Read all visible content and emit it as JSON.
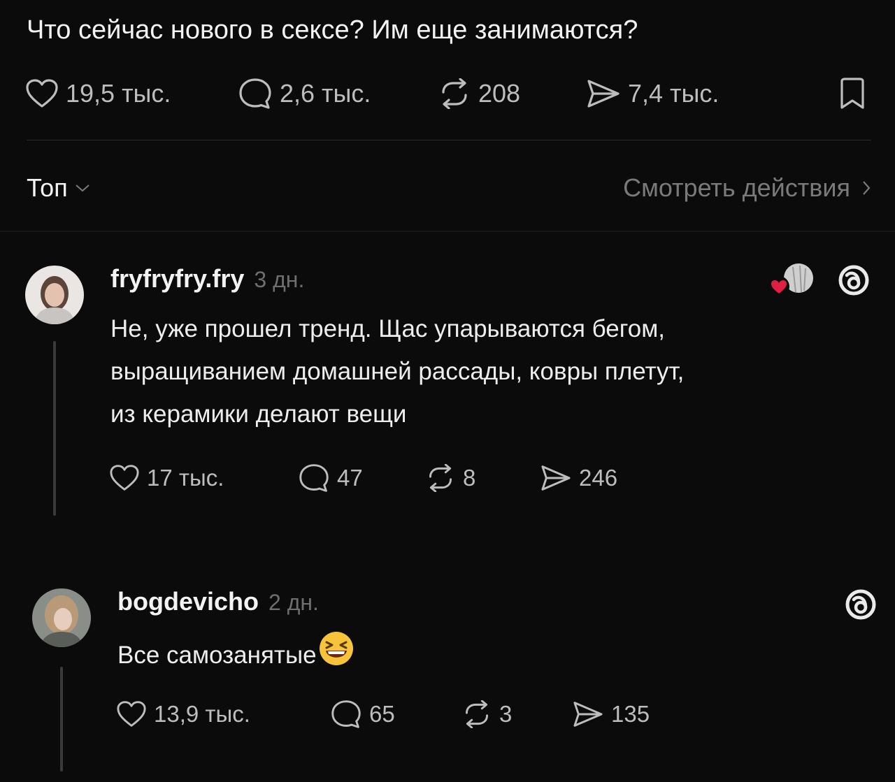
{
  "post": {
    "text": "Что сейчас нового в сексе? Им еще занимаются?",
    "likes": "19,5 тыс.",
    "replies": "2,6 тыс.",
    "reposts": "208",
    "shares": "7,4 тыс."
  },
  "sort_bar": {
    "sort_label": "Топ",
    "view_activity": "Смотреть действия"
  },
  "comments": [
    {
      "username": "fryfryfry.fry",
      "time": "3 дн.",
      "text_lines": [
        "Не, уже прошел тренд. Щас упарываются бегом,",
        "выращиванием домашней рассады, ковры плетут,",
        "из керамики делают вещи"
      ],
      "likes": "17 тыс.",
      "replies": "47",
      "reposts": "8",
      "shares": "246"
    },
    {
      "username": "bogdevicho",
      "time": "2 дн.",
      "text": "Все самозанятые",
      "emoji": "😆",
      "likes": "13,9 тыс.",
      "replies": "65",
      "reposts": "3",
      "shares": "135"
    }
  ],
  "colors": {
    "background": "#0c0b0c",
    "text": "#f3f3f3",
    "muted": "#7a7a7a",
    "icon": "#bdbdbd",
    "like_badge": "#e02040"
  },
  "icons": [
    "heart-icon",
    "comment-icon",
    "repost-icon",
    "share-icon",
    "bookmark-icon",
    "chevron-down-icon",
    "chevron-right-icon",
    "threads-logo-icon"
  ]
}
